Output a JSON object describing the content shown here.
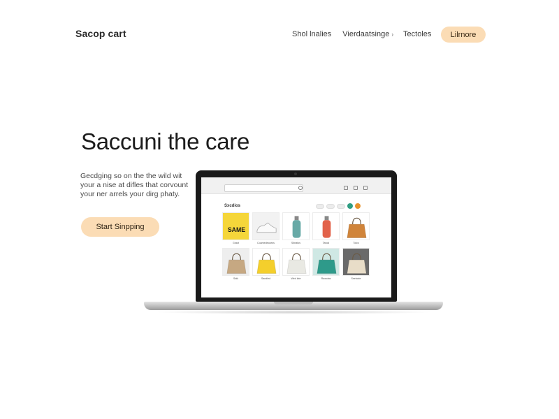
{
  "header": {
    "brand": "Sacop cart",
    "nav": [
      "Shol lnalies",
      "Vierdaatsinge",
      "Tectoles"
    ],
    "cta": "Lilrnore"
  },
  "hero": {
    "title": "Saccuni the care",
    "subtitle_lines": [
      "Gecdging so on the the wild wit",
      "your a nise at difles that corvount",
      "your ner arrels your dirg phaty."
    ],
    "cta": "Start Sinpping"
  },
  "laptop": {
    "search_placeholder": "",
    "section_label": "Sxcdios",
    "products": [
      {
        "name": "Graot",
        "color": "#f5d63a",
        "shape": "sign",
        "text": "SAME"
      },
      {
        "name": "Coamedecoess",
        "color": "#f2f2f2",
        "shape": "shoe"
      },
      {
        "name": "Sibratos",
        "color": "#ffffff",
        "shape": "bottle",
        "fill": "#67a9a6"
      },
      {
        "name": "Tavod",
        "color": "#ffffff",
        "shape": "bottle",
        "fill": "#e2624a"
      },
      {
        "name": "Tolcs",
        "color": "#ffffff",
        "shape": "bag",
        "fill": "#d0843a"
      },
      {
        "name": "Stdk",
        "color": "#eeeeee",
        "shape": "bag",
        "fill": "#c6a882"
      },
      {
        "name": "Sandled",
        "color": "#ffffff",
        "shape": "bag",
        "fill": "#f4cf2c"
      },
      {
        "name": "Wed lote",
        "color": "#ffffff",
        "shape": "bag",
        "fill": "#e9e9e3"
      },
      {
        "name": "Rawolas",
        "color": "#cfe8e4",
        "shape": "bag",
        "fill": "#2e9a8a"
      },
      {
        "name": "Seelacte",
        "color": "#6a6a6a",
        "shape": "bag",
        "fill": "#e8ddc8"
      }
    ]
  },
  "colors": {
    "accent": "#fbdcb5",
    "teal_dot": "#2f9e83",
    "orange_dot": "#e8922c"
  }
}
